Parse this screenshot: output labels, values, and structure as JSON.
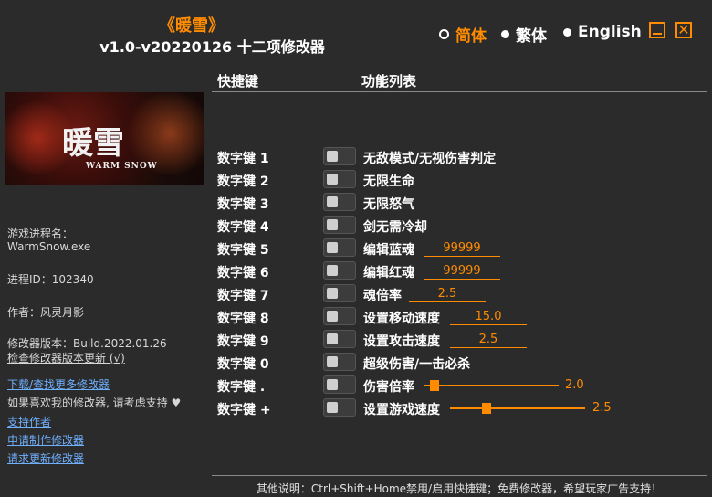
{
  "header": {
    "game_title": "《暖雪》",
    "version_title": "v1.0-v20220126 十二项修改器"
  },
  "languages": [
    {
      "label": "简体",
      "selected": true
    },
    {
      "label": "繁体",
      "selected": false
    },
    {
      "label": "English",
      "selected": false
    }
  ],
  "window": {
    "minimize_icon": "minimize-icon",
    "close_icon": "close-icon",
    "close_glyph": "✕"
  },
  "columns": {
    "hotkey": "快捷键",
    "features": "功能列表"
  },
  "banner": {
    "logo_text": "暖雪",
    "logo_sub": "WARM SNOW"
  },
  "info": {
    "process_label": "游戏进程名：",
    "process_name": "WarmSnow.exe",
    "pid": "进程ID：102340",
    "author": "作者：风灵月影",
    "build": "修改器版本：Build.2022.01.26",
    "check_update": "检查修改器版本更新 (√)",
    "link_download": "下载/查找更多修改器",
    "support_text": "如果喜欢我的修改器, 请考虑支持 ♥",
    "link_support": "支持作者",
    "link_request": "申请制作修改器",
    "link_update": "请求更新修改器"
  },
  "cheats": [
    {
      "key": "数字键 1",
      "label": "无敌模式/无视伤害判定"
    },
    {
      "key": "数字键 2",
      "label": "无限生命"
    },
    {
      "key": "数字键 3",
      "label": "无限怒气"
    },
    {
      "key": "数字键 4",
      "label": "剑无需冷却"
    },
    {
      "key": "数字键 5",
      "label": "编辑蓝魂",
      "value": "99999"
    },
    {
      "key": "数字键 6",
      "label": "编辑红魂",
      "value": "99999"
    },
    {
      "key": "数字键 7",
      "label": "魂倍率",
      "value": "2.5"
    },
    {
      "key": "数字键 8",
      "label": "设置移动速度",
      "value": "15.0"
    },
    {
      "key": "数字键 9",
      "label": "设置攻击速度",
      "value": "2.5"
    },
    {
      "key": "数字键 0",
      "label": "超级伤害/一击必杀"
    },
    {
      "key": "数字键 .",
      "label": "伤害倍率",
      "value": "2.0",
      "slider_fraction": 0.05
    },
    {
      "key": "数字键 +",
      "label": "设置游戏速度",
      "value": "2.5",
      "slider_fraction": 0.25
    }
  ],
  "footer": "其他说明：Ctrl+Shift+Home禁用/启用快捷键；免费修改器，希望玩家广告支持！",
  "colors": {
    "accent": "#ff8c00",
    "background": "#2b2b2b",
    "link": "#6fb0ff"
  }
}
